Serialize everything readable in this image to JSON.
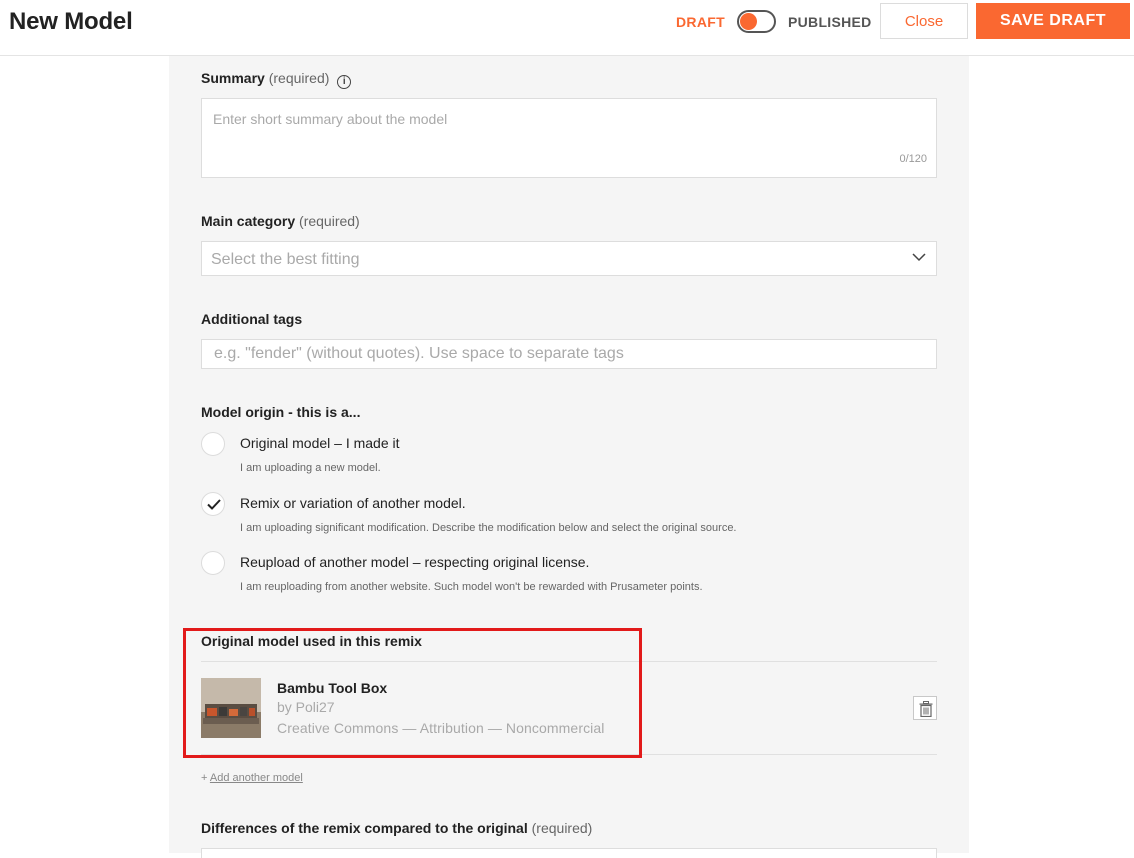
{
  "header": {
    "title": "New Model",
    "draft_label": "DRAFT",
    "published_label": "PUBLISHED",
    "close_label": "Close",
    "save_label": "SAVE DRAFT",
    "accent_color": "#fa6831"
  },
  "summary": {
    "label": "Summary",
    "required": "(required)",
    "placeholder": "Enter short summary about the model",
    "counter": "0/120"
  },
  "category": {
    "label": "Main category",
    "required": "(required)",
    "placeholder": "Select the best fitting"
  },
  "tags": {
    "label": "Additional tags",
    "placeholder": "e.g. \"fender\" (without quotes). Use space to separate tags"
  },
  "origin": {
    "label": "Model origin - this is a...",
    "options": [
      {
        "title": "Original model – I made it",
        "description": "I am uploading a new model.",
        "selected": false
      },
      {
        "title": "Remix or variation of another model.",
        "description": "I am uploading significant modification. Describe the modification below and select the original source.",
        "selected": true
      },
      {
        "title": "Reupload of another model – respecting original license.",
        "description": "I am reuploading from another website. Such model won't be rewarded with Prusameter points.",
        "selected": false
      }
    ]
  },
  "remix": {
    "label": "Original model used in this remix",
    "model": {
      "name": "Bambu Tool Box",
      "author": "by Poli27",
      "license": "Creative Commons — Attribution — Noncommercial"
    },
    "add_prefix": "+",
    "add_label": "Add another model"
  },
  "differences": {
    "label": "Differences of the remix compared to the original",
    "required": "(required)"
  },
  "icons": {
    "summary_info": "info-icon",
    "category_dropdown": "chevron-down-icon",
    "selected_radio": "checkmark-icon",
    "remove_model": "trash-icon"
  }
}
